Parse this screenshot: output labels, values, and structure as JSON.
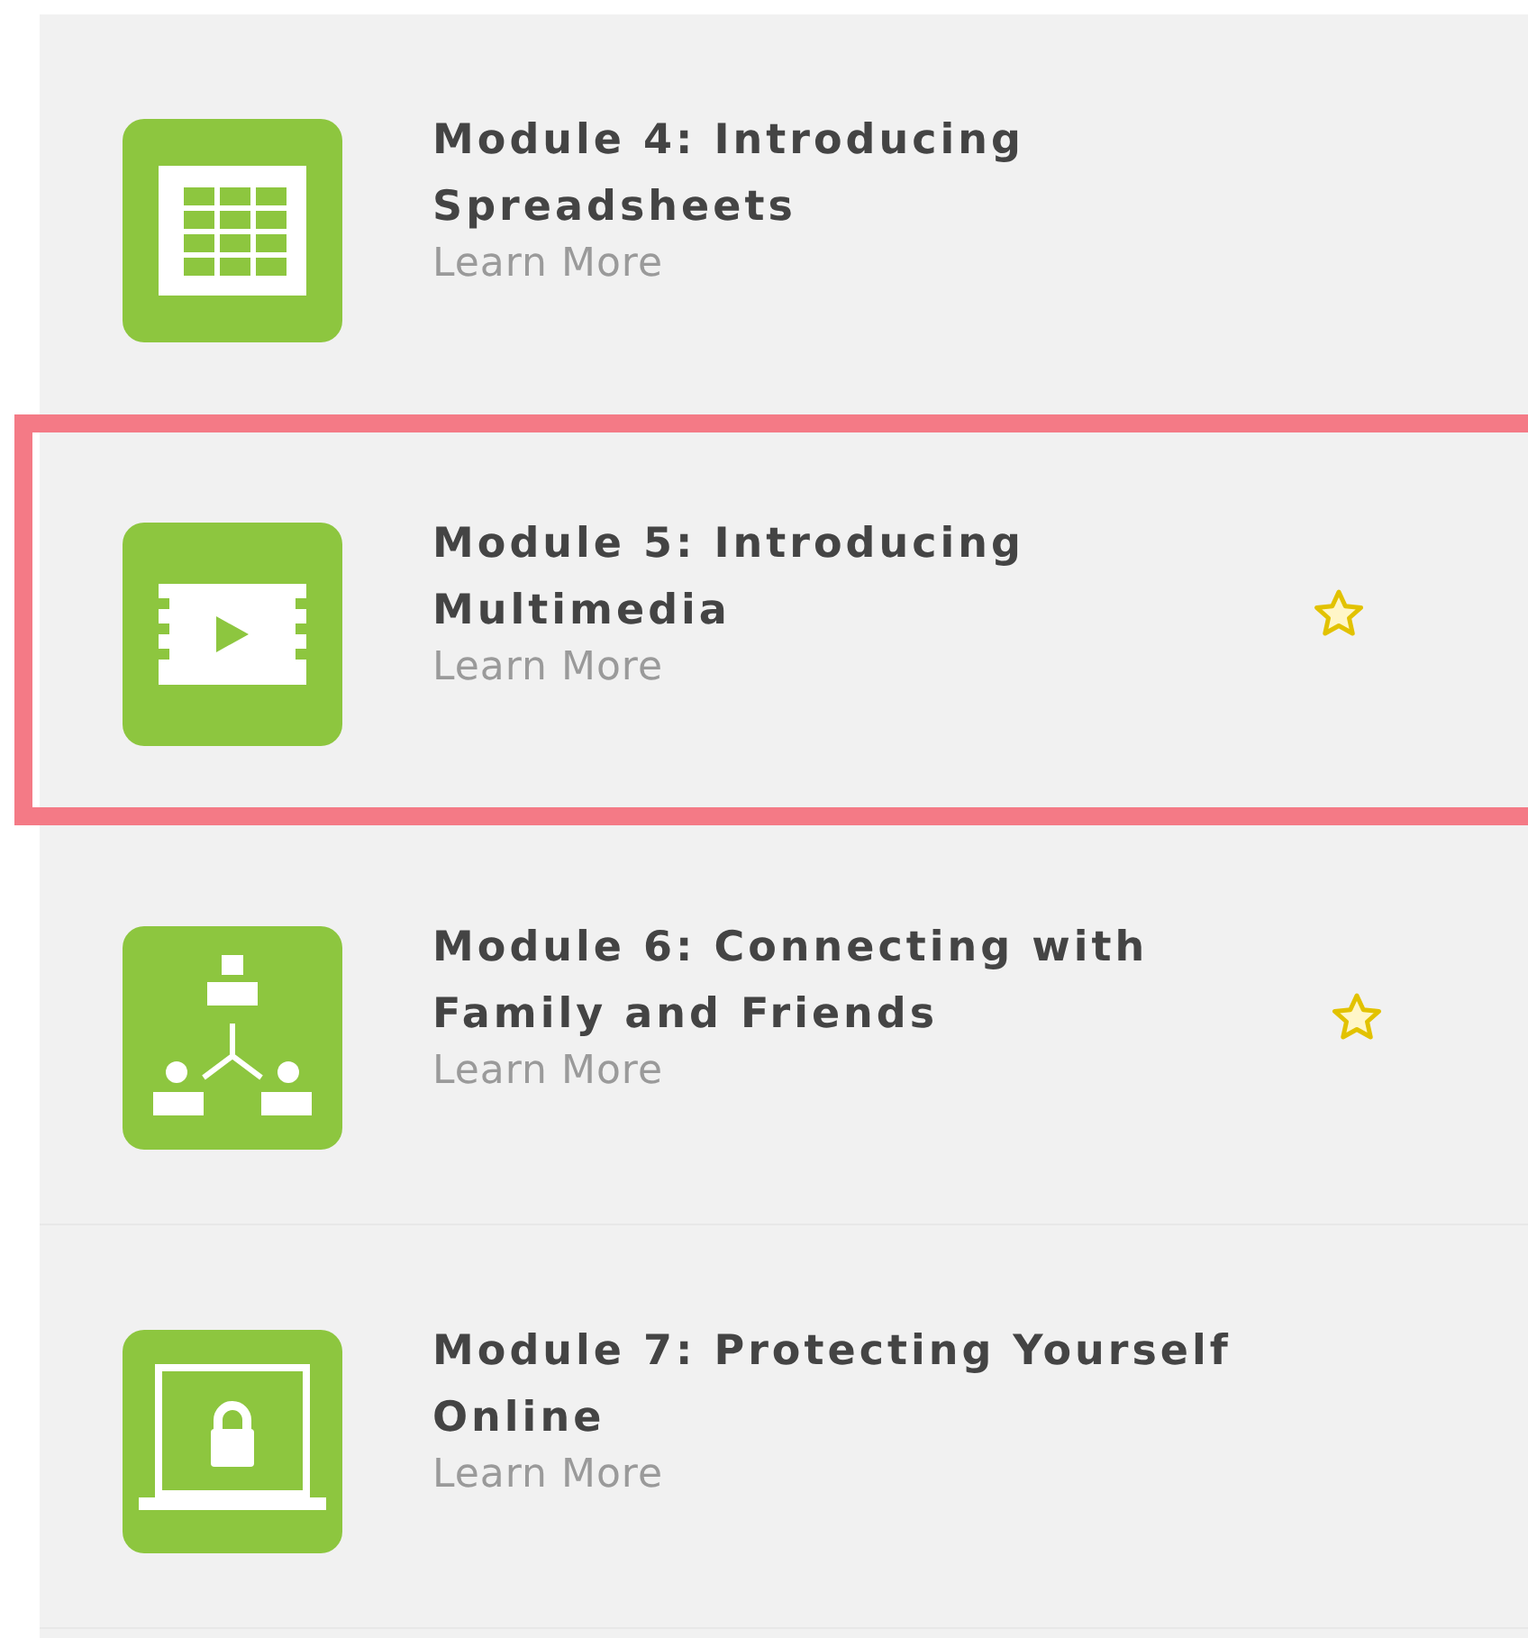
{
  "modules": [
    {
      "kind": "spreadsheet",
      "title": "Module 4: Introducing Spreadsheets",
      "link": "Learn More",
      "starred": false,
      "highlighted": false
    },
    {
      "kind": "video",
      "title": "Module 5: Introducing Multimedia",
      "link": "Learn More",
      "starred": true,
      "highlighted": true
    },
    {
      "kind": "people",
      "title": "Module 6: Connecting with Family and Friends",
      "link": "Learn More",
      "starred": true,
      "highlighted": false
    },
    {
      "kind": "laptop-lock",
      "title": "Module 7: Protecting Yourself Online",
      "link": "Learn More",
      "starred": false,
      "highlighted": false
    }
  ]
}
